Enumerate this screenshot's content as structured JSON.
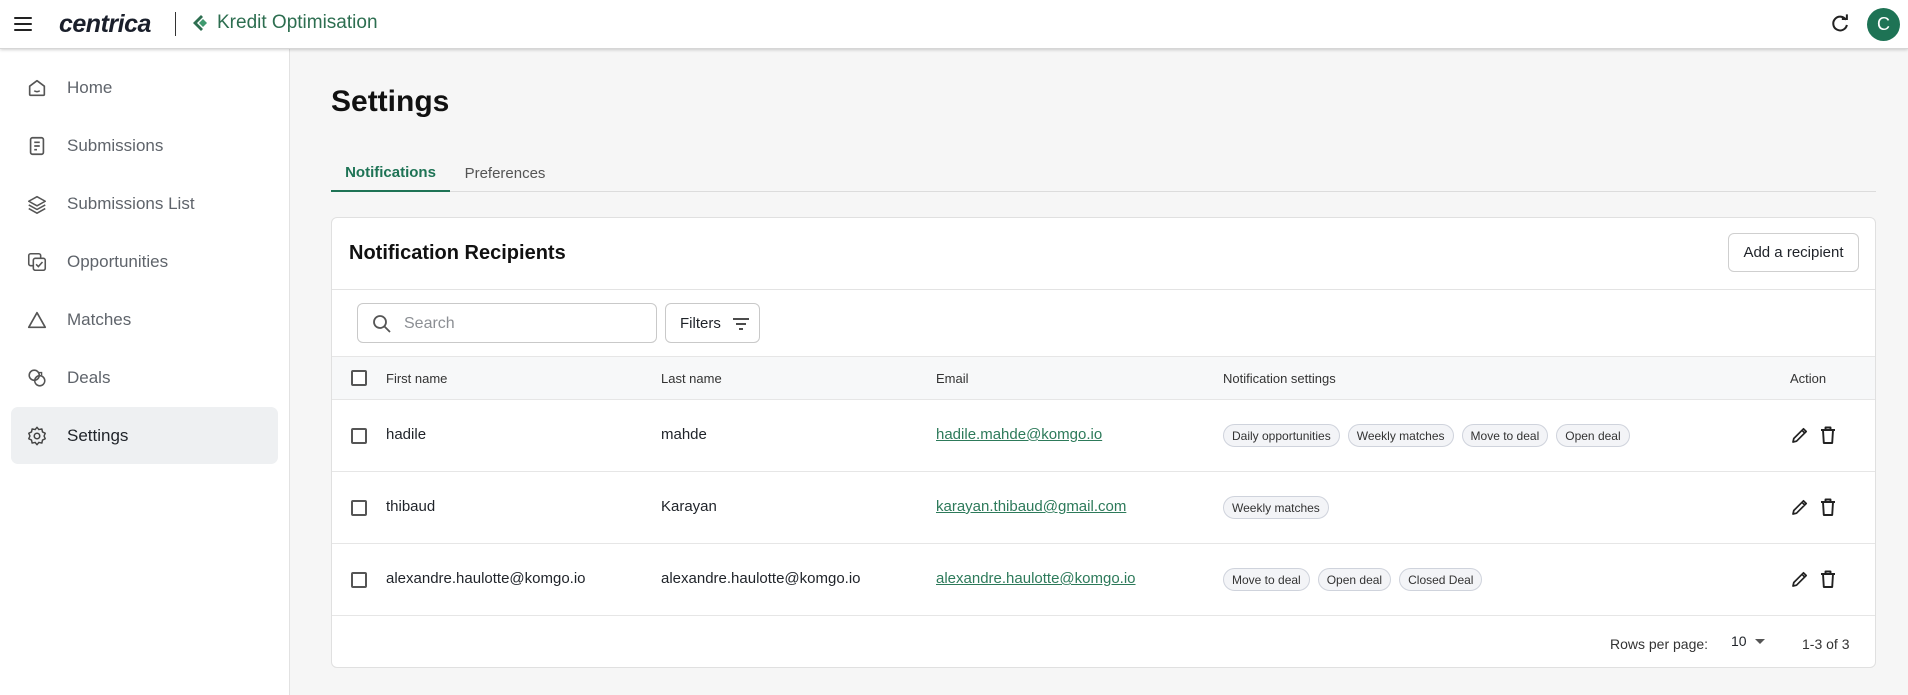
{
  "header": {
    "brand": "centrica",
    "product": "Kredit Optimisation",
    "avatar_initial": "C",
    "accent_color": "#1e7355"
  },
  "sidebar": {
    "items": [
      {
        "label": "Home",
        "icon": "home-icon",
        "active": false
      },
      {
        "label": "Submissions",
        "icon": "document-icon",
        "active": false
      },
      {
        "label": "Submissions List",
        "icon": "layers-icon",
        "active": false
      },
      {
        "label": "Opportunities",
        "icon": "checkbox-stack-icon",
        "active": false
      },
      {
        "label": "Matches",
        "icon": "triangle-icon",
        "active": false
      },
      {
        "label": "Deals",
        "icon": "deals-icon",
        "active": false
      },
      {
        "label": "Settings",
        "icon": "gear-icon",
        "active": true
      }
    ]
  },
  "page": {
    "title": "Settings",
    "tabs": [
      {
        "label": "Notifications",
        "active": true
      },
      {
        "label": "Preferences",
        "active": false
      }
    ]
  },
  "card": {
    "title": "Notification Recipients",
    "add_button": "Add a recipient",
    "search_placeholder": "Search",
    "filters_label": "Filters"
  },
  "table": {
    "columns": [
      "First name",
      "Last name",
      "Email",
      "Notification settings",
      "Action"
    ],
    "rows": [
      {
        "first": "hadile",
        "last": "mahde",
        "email": "hadile.mahde@komgo.io",
        "settings": [
          "Daily opportunities",
          "Weekly matches",
          "Move to deal",
          "Open deal"
        ]
      },
      {
        "first": "thibaud",
        "last": "Karayan",
        "email": "karayan.thibaud@gmail.com",
        "settings": [
          "Weekly matches"
        ]
      },
      {
        "first": "alexandre.haulotte@komgo.io",
        "last": "alexandre.haulotte@komgo.io",
        "email": "alexandre.haulotte@komgo.io",
        "settings": [
          "Move to deal",
          "Open deal",
          "Closed Deal"
        ]
      }
    ]
  },
  "pagination": {
    "rows_per_page_label": "Rows per page:",
    "rows_per_page_value": "10",
    "range": "1-3 of 3"
  }
}
